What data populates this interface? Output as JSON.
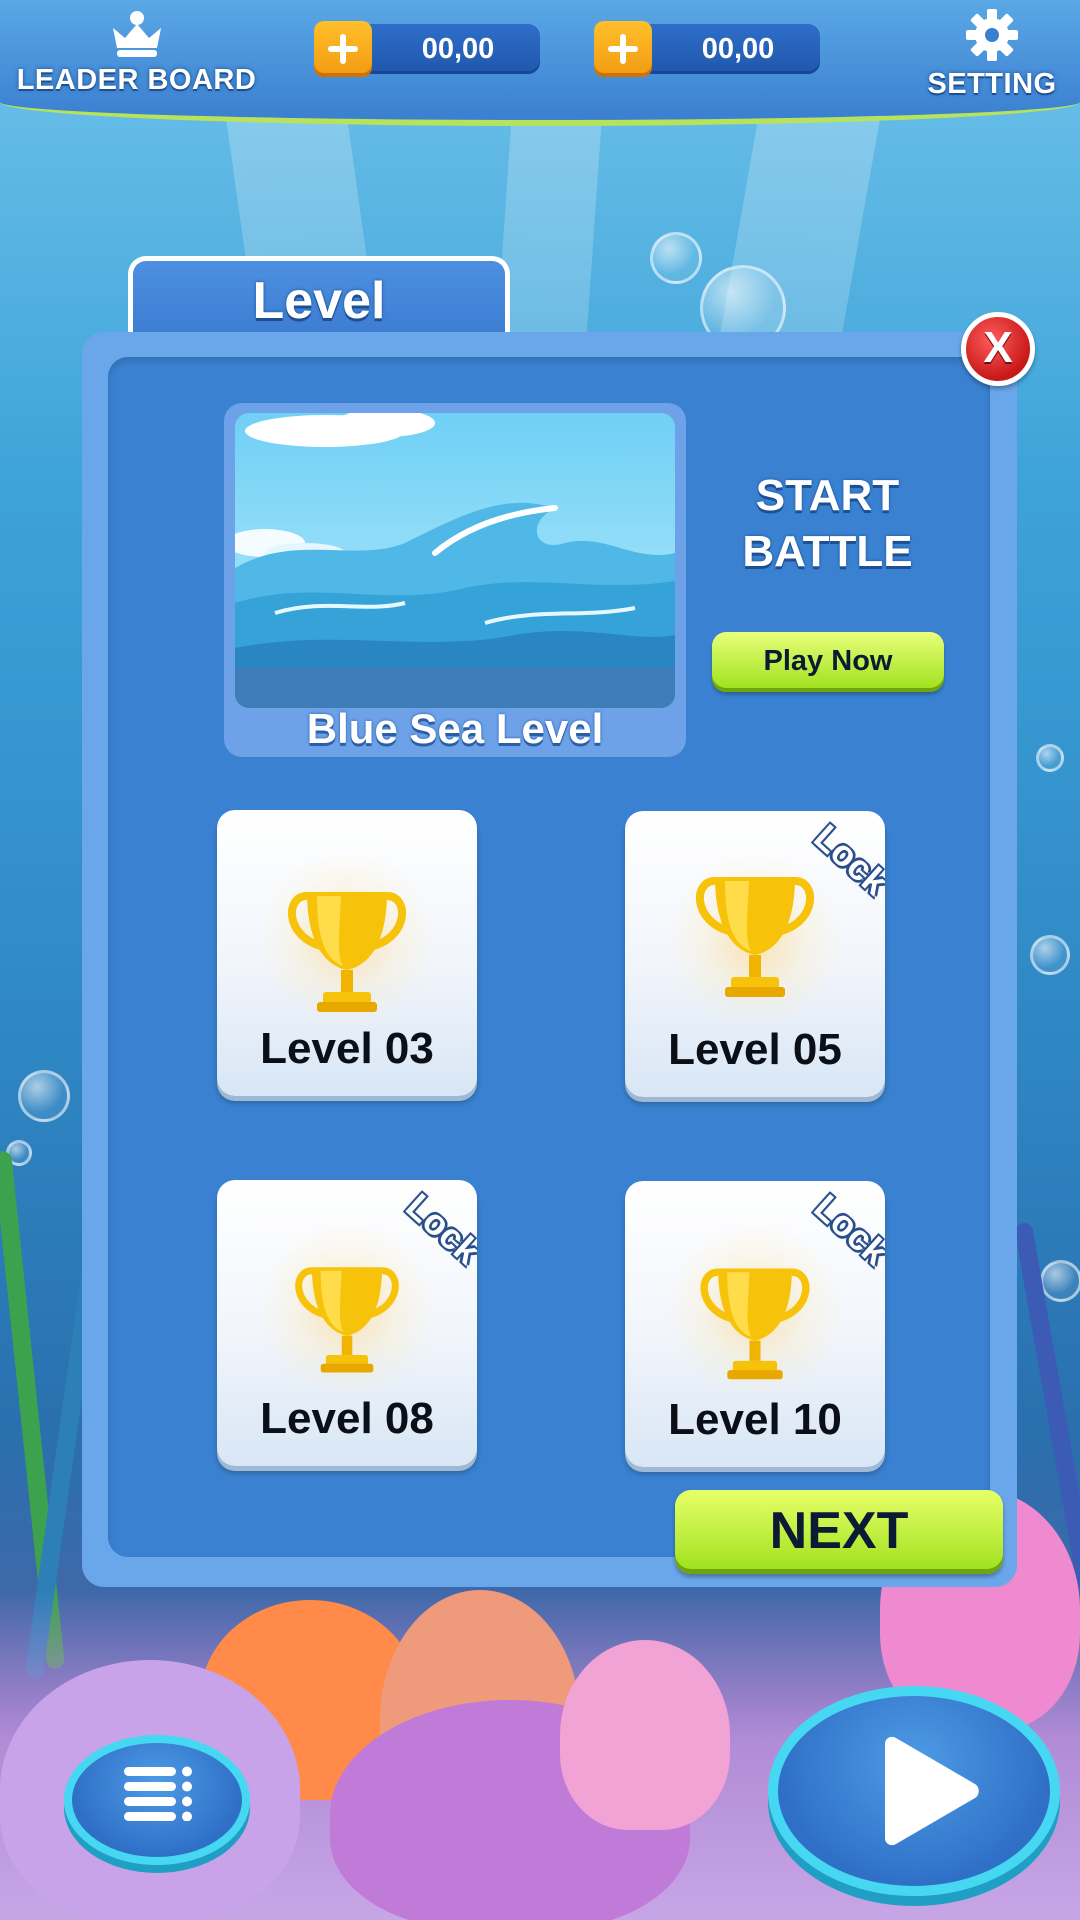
{
  "topbar": {
    "leaderboard_label": "LEADER BOARD",
    "setting_label": "SETTING",
    "currency": [
      {
        "amount": "00,00",
        "icon": "plus-icon"
      },
      {
        "amount": "00,00",
        "icon": "plus-icon"
      }
    ]
  },
  "panel": {
    "tab_title": "Level",
    "close_label": "X",
    "featured": {
      "name": "Blue Sea Level",
      "start_line1": "START",
      "start_line2": "BATTLE",
      "play_label": "Play Now"
    },
    "levels": [
      {
        "label": "Level 03",
        "locked": false
      },
      {
        "label": "Level 05",
        "locked": true,
        "lock_label": "Lock"
      },
      {
        "label": "Level 08",
        "locked": true,
        "lock_label": "Lock"
      },
      {
        "label": "Level 10",
        "locked": true,
        "lock_label": "Lock"
      }
    ],
    "next_label": "NEXT"
  },
  "bottom": {
    "menu_icon": "menu-list-icon",
    "play_icon": "play-icon"
  },
  "colors": {
    "panel": "#3a82d1",
    "accent_green": "#9de01a",
    "close_red": "#c81818",
    "trophy_gold": "#f7c20a"
  }
}
